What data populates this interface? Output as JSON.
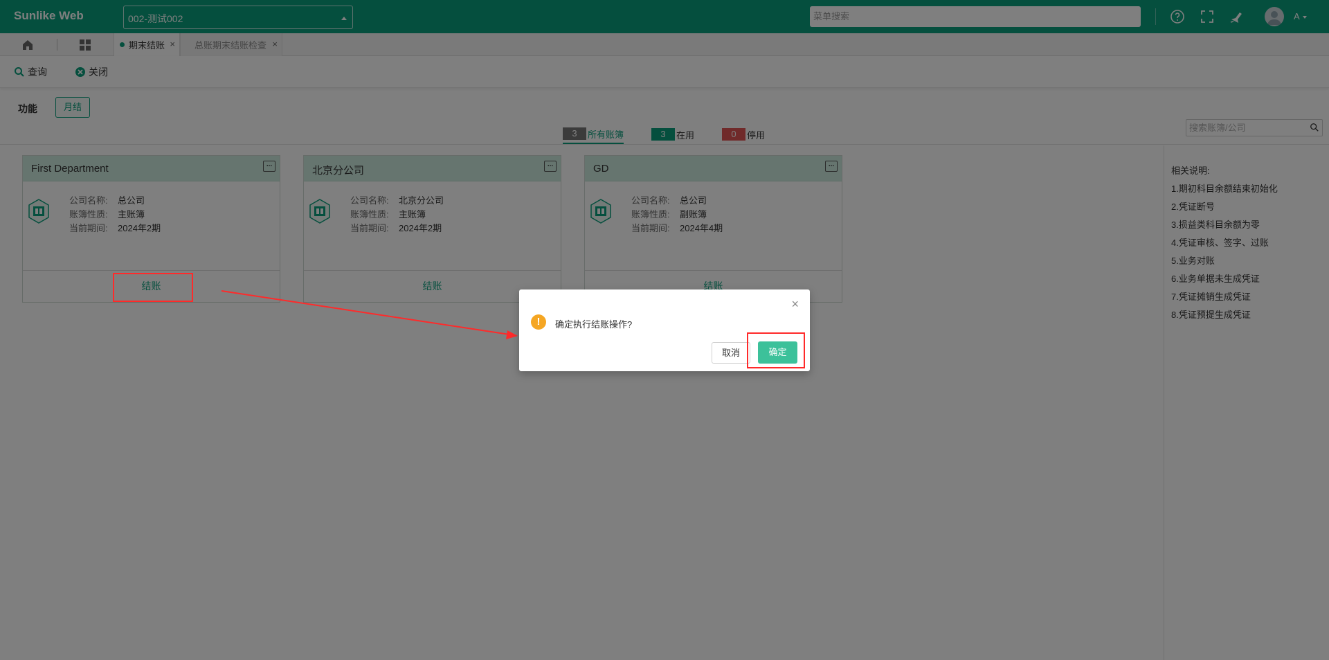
{
  "header": {
    "app_title": "Sunlike Web",
    "account_select_value": "002-测试002",
    "menu_search_placeholder": "菜单搜索",
    "user_label": "A"
  },
  "tabs": [
    {
      "label": "期末结账",
      "active": true
    },
    {
      "label": "总账期末结账检查",
      "active": false
    }
  ],
  "toolbar": {
    "query_label": "查询",
    "close_label": "关闭"
  },
  "function": {
    "label": "功能",
    "monthly_close_label": "月结"
  },
  "filters": {
    "all": {
      "count": "3",
      "label": "所有账簿"
    },
    "in_use": {
      "count": "3",
      "label": "在用"
    },
    "disabled": {
      "count": "0",
      "label": "停用"
    }
  },
  "ledger_search_placeholder": "搜索账簿/公司",
  "cards": [
    {
      "title": "First Department",
      "company_label": "公司名称:",
      "company": "总公司",
      "nature_label": "账簿性质:",
      "nature": "主账簿",
      "period_label": "当前期间:",
      "period": "2024年2期",
      "action": "结账"
    },
    {
      "title": "北京分公司",
      "company_label": "公司名称:",
      "company": "北京分公司",
      "nature_label": "账簿性质:",
      "nature": "主账簿",
      "period_label": "当前期间:",
      "period": "2024年2期",
      "action": "结账"
    },
    {
      "title": "GD",
      "company_label": "公司名称:",
      "company": "总公司",
      "nature_label": "账簿性质:",
      "nature": "副账簿",
      "period_label": "当前期间:",
      "period": "2024年4期",
      "action": "结账"
    }
  ],
  "notes": {
    "title": "相关说明:",
    "items": [
      "1.期初科目余额结束初始化",
      "2.凭证断号",
      "3.损益类科目余额为零",
      "4.凭证审核、签字、过账",
      "5.业务对账",
      "6.业务单据未生成凭证",
      "7.凭证摊销生成凭证",
      "8.凭证预提生成凭证"
    ]
  },
  "dialog": {
    "message": "确定执行结账操作?",
    "cancel_label": "取消",
    "ok_label": "确定"
  },
  "colors": {
    "brand": "#0b9e7c",
    "confirm": "#3cc19a",
    "warning": "#f5a623",
    "annotation": "#ff2a2a"
  }
}
